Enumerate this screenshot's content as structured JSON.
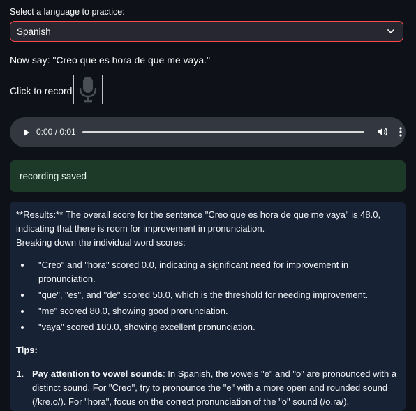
{
  "language_selector": {
    "label": "Select a language to practice:",
    "selected": "Spanish",
    "accent_color": "#ff4b4b"
  },
  "prompt": {
    "text": "Now say: \"Creo que es hora de que me vaya.\""
  },
  "recorder": {
    "label": "Click to record",
    "icon": "microphone-icon"
  },
  "audio_player": {
    "time": "0:00 / 0:01",
    "progress": 0
  },
  "status": {
    "message": "recording saved",
    "color": "#1d3a29"
  },
  "results": {
    "intro": "**Results:** The overall score for the sentence \"Creo que es hora de que me vaya\" is 48.0, indicating that there is room for improvement in pronunciation.",
    "breakdown_heading": "Breaking down the individual word scores:",
    "word_scores": [
      "\"Creo\" and \"hora\" scored 0.0, indicating a significant need for improvement in pronunciation.",
      "\"que\", \"es\", and \"de\" scored 50.0, which is the threshold for needing improvement.",
      "\"me\" scored 80.0, showing good pronunciation.",
      "\"vaya\" scored 100.0, showing excellent pronunciation."
    ],
    "tips_heading": "Tips:",
    "tips": [
      {
        "title": "Pay attention to vowel sounds",
        "text": ": In Spanish, the vowels \"e\" and \"o\" are pronounced with a distinct sound. For \"Creo\", try to pronounce the \"e\" with a more open and rounded sound (/kre.o/). For \"hora\", focus on the correct pronunciation of the \"o\" sound (/o.ra/)."
      }
    ]
  }
}
